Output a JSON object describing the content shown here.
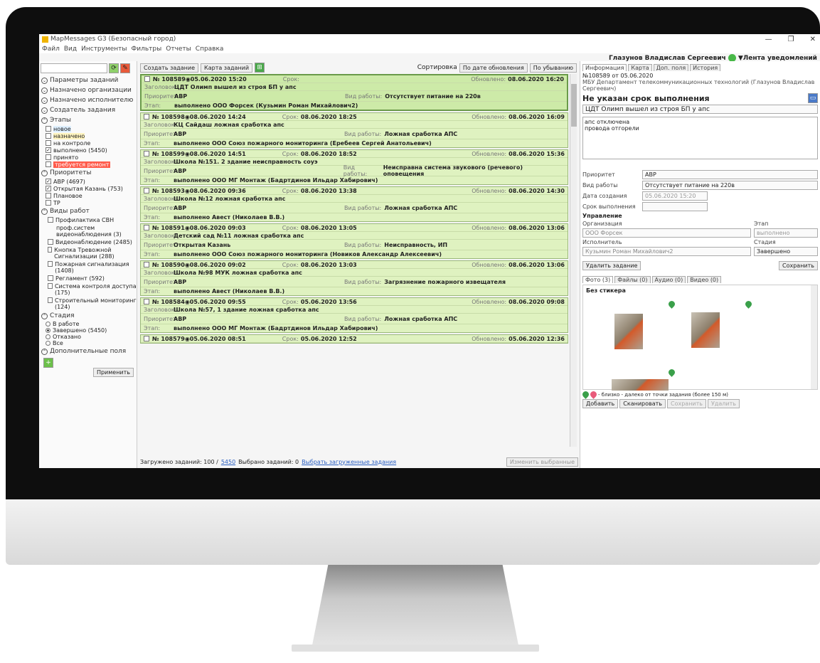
{
  "window": {
    "title": "MapMessages G3 (Безопасный город)",
    "minimize": "—",
    "maximize": "❐",
    "close": "✕"
  },
  "menu": [
    "Файл",
    "Вид",
    "Инструменты",
    "Фильтры",
    "Отчеты",
    "Справка"
  ],
  "user": {
    "name": "Глазунов Владислав Сергеевич",
    "feed": "▼Лента уведомлений"
  },
  "left": {
    "sections": {
      "params": "Параметры заданий",
      "orgs": "Назначено организации",
      "exec": "Назначено исполнителю",
      "created": "Создатель задания",
      "stages": "Этапы",
      "priorities": "Приоритеты",
      "worktypes": "Виды работ",
      "stadia": "Стадия",
      "extra": "Дополнительные поля"
    },
    "stages": [
      {
        "label": "новое",
        "checked": false,
        "color": "#dff0ff"
      },
      {
        "label": "назначено",
        "checked": false,
        "color": "#fff4c0"
      },
      {
        "label": "на контроле",
        "checked": false,
        "color": ""
      },
      {
        "label": "выполнено (5450)",
        "checked": true,
        "color": ""
      },
      {
        "label": "принято",
        "checked": false,
        "color": ""
      },
      {
        "label": "требуется ремонт",
        "checked": false,
        "color": "#ff5a4a"
      }
    ],
    "priorities": [
      {
        "label": "АВР (4697)",
        "checked": true
      },
      {
        "label": "Открытая Казань (753)",
        "checked": true
      },
      {
        "label": "Плановое",
        "checked": false
      },
      {
        "label": "ТР",
        "checked": false
      }
    ],
    "worktypes": [
      "Профилактика СВН",
      "проф.систем видеонаблюдения (3)",
      "Видеонаблюдение (2485)",
      "Кнопка Тревожной Сигнализации (288)",
      "Пожарная сигнализация (1408)",
      "Регламент (592)",
      "Система контроля доступа (175)",
      "Строительный мониторинг (124)"
    ],
    "stadia": [
      {
        "label": "В работе",
        "on": false
      },
      {
        "label": "Завершено (5450)",
        "on": true
      },
      {
        "label": "Отказано",
        "on": false
      },
      {
        "label": "Все",
        "on": false
      }
    ],
    "apply": "Применить"
  },
  "toolbar": {
    "create": "Создать задание",
    "map": "Карта заданий",
    "sort_label": "Сортировка",
    "sort_by": "По дате обновления",
    "order": "По убыванию"
  },
  "labels": {
    "customer": "Заголовок:",
    "priority": "Приоритет:",
    "stage": "Этап:",
    "deadline": "Срок:",
    "updated": "Обновлено:",
    "worktype": "Вид работы:"
  },
  "tasks": [
    {
      "id": "№ 108589",
      "date": "05.06.2020 15:20",
      "deadline": "",
      "updated": "08.06.2020 16:20",
      "title": "ЦДТ Олимп вышел из строя БП у апс",
      "priority": "АВР",
      "worktype": "Отсутствует питание на 220в",
      "stage": "выполнено ООО Форсек (Кузьмин Роман Михайлович2)"
    },
    {
      "id": "№ 108598",
      "date": "08.06.2020 14:24",
      "deadline": "08.06.2020 18:25",
      "updated": "08.06.2020 16:09",
      "title": "КЦ Сайдаш ложная сработка апс",
      "priority": "АВР",
      "worktype": "Ложная сработка АПС",
      "stage": "выполнено ООО Союз пожарного мониторинга (Еребеев Сергей Анатольевич)"
    },
    {
      "id": "№ 108599",
      "date": "08.06.2020 14:51",
      "deadline": "08.06.2020 18:52",
      "updated": "08.06.2020 15:36",
      "title": "Школа №151. 2 здание неисправность соуэ",
      "priority": "АВР",
      "worktype": "Неисправна система звукового (речевого) оповещения",
      "stage": "выполнено ООО МГ Монтаж (Бадртдинов Ильдар Хабирович)"
    },
    {
      "id": "№ 108593",
      "date": "08.06.2020 09:36",
      "deadline": "08.06.2020 13:38",
      "updated": "08.06.2020 14:30",
      "title": "Школа №12 ложная сработка апс",
      "priority": "АВР",
      "worktype": "Ложная сработка АПС",
      "stage": "выполнено Авест (Николаев В.В.)"
    },
    {
      "id": "№ 108591",
      "date": "08.06.2020 09:03",
      "deadline": "08.06.2020 13:05",
      "updated": "08.06.2020 13:06",
      "title": "Детский сад №11 ложная сработка апс",
      "priority": "Открытая Казань",
      "worktype": "Неисправность, ИП",
      "stage": "выполнено ООО Союз пожарного мониторинга (Новиков Александр Алексеевич)"
    },
    {
      "id": "№ 108590",
      "date": "08.06.2020 09:02",
      "deadline": "08.06.2020 13:03",
      "updated": "08.06.2020 13:06",
      "title": "Школа №98 МУК ложная сработка апс",
      "priority": "АВР",
      "worktype": "Загрязнение пожарного извещателя",
      "stage": "выполнено Авест (Николаев В.В.)"
    },
    {
      "id": "№ 108584",
      "date": "05.06.2020 09:55",
      "deadline": "05.06.2020 13:56",
      "updated": "08.06.2020 09:08",
      "title": "Школа №57, 1 здание ложная сработка апс",
      "priority": "АВР",
      "worktype": "Ложная сработка АПС",
      "stage": "выполнено ООО МГ Монтаж (Бадртдинов Ильдар Хабирович)"
    }
  ],
  "partial": {
    "id": "№ 108579",
    "date": "05.06.2020 08:51",
    "deadline": "05.06.2020 12:52",
    "updated": "05.06.2020 12:36"
  },
  "status": {
    "loaded": "Загружено заданий: 100 /",
    "total": "5450",
    "selected": "Выбрано заданий: 0",
    "select_loaded": "Выбрать загруженные задания",
    "change": "Изменить выбранные"
  },
  "right": {
    "tabs": [
      "Информация",
      "Карта",
      "Доп. поля",
      "История"
    ],
    "head": "№108589 от 05.06.2020",
    "org": "МБУ Департамент телекоммуникационных технологий (Глазунов Владислав Сергеевич)",
    "deadline_title": "Не указан срок выполнения",
    "task_title": "ЦДТ Олимп вышел из строя БП у апс",
    "comment": "апс отключена\nпровода отгорели",
    "priority_l": "Приоритет",
    "priority_v": "АВР",
    "worktype_l": "Вид работы",
    "worktype_v": "Отсутствует питание на 220в",
    "created_l": "Дата создания",
    "created_v": "05.06.2020 15:20",
    "deadline_l": "Срок выполнения",
    "control": "Управление",
    "org_l": "Организация",
    "org_v": "ООО Форсек",
    "stage_l": "Этап",
    "stage_v": "выполнено",
    "exec_l": "Исполнитель",
    "exec_v": "Кузьмин Роман Михайлович2",
    "stadia_l": "Стадия",
    "stadia_v": "Завершено",
    "delete": "Удалить задание",
    "save": "Сохранить",
    "media_tabs": [
      "Фото (3)",
      "Файлы (0)",
      "Аудио (0)",
      "Видео (0)"
    ],
    "sticker": "Без стикера",
    "legend": "- близко   - далеко от точки задания (более 150 м)",
    "actions": [
      "Добавить",
      "Сканировать",
      "Сохранить",
      "Удалить"
    ]
  }
}
